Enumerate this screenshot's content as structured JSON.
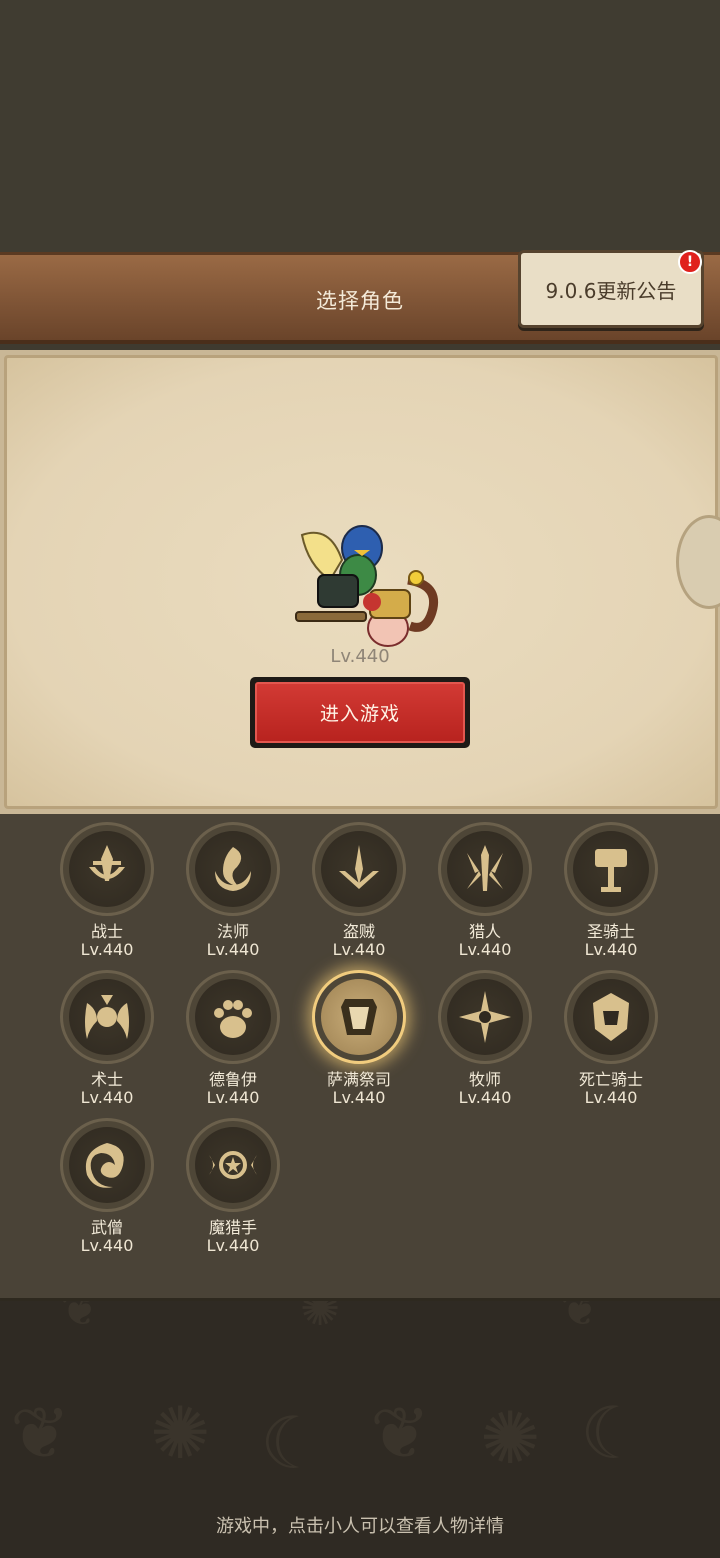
{
  "header": {
    "title": "选择角色",
    "notice_label": "9.0.6更新公告",
    "notice_alert": "!"
  },
  "character": {
    "level": "Lv.440",
    "enter_label": "进入游戏"
  },
  "classes": [
    {
      "name": "战士",
      "level": "Lv.440",
      "icon": "warrior-icon"
    },
    {
      "name": "法师",
      "level": "Lv.440",
      "icon": "mage-icon"
    },
    {
      "name": "盗贼",
      "level": "Lv.440",
      "icon": "rogue-icon"
    },
    {
      "name": "猎人",
      "level": "Lv.440",
      "icon": "hunter-icon"
    },
    {
      "name": "圣骑士",
      "level": "Lv.440",
      "icon": "paladin-icon"
    },
    {
      "name": "术士",
      "level": "Lv.440",
      "icon": "warlock-icon"
    },
    {
      "name": "德鲁伊",
      "level": "Lv.440",
      "icon": "druid-icon"
    },
    {
      "name": "萨满祭司",
      "level": "Lv.440",
      "icon": "shaman-icon",
      "selected": true
    },
    {
      "name": "牧师",
      "level": "Lv.440",
      "icon": "priest-icon"
    },
    {
      "name": "死亡骑士",
      "level": "Lv.440",
      "icon": "death-knight-icon"
    },
    {
      "name": "武僧",
      "level": "Lv.440",
      "icon": "monk-icon"
    },
    {
      "name": "魔猎手",
      "level": "Lv.440",
      "icon": "demon-hunter-icon"
    }
  ],
  "footer": {
    "hint": "游戏中，点击小人可以查看人物详情"
  },
  "colors": {
    "accent_red": "#c42c27",
    "gold": "#d8c08d",
    "panel": "#4a4337"
  }
}
